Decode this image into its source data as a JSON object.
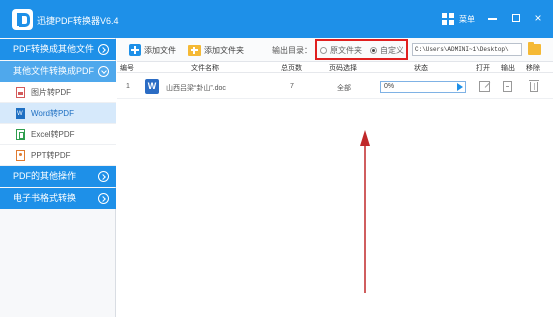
{
  "window": {
    "title": "迅捷PDF转换器V6.4",
    "menu_label": "菜单",
    "close_glyph": "×"
  },
  "sidebar": {
    "sections": [
      {
        "label": "PDF转换成其他文件"
      },
      {
        "label": "其他文件转换成PDF"
      },
      {
        "label": "PDF的其他操作"
      },
      {
        "label": "电子书格式转换"
      }
    ],
    "items": [
      {
        "label": "图片转PDF"
      },
      {
        "label": "Word转PDF"
      },
      {
        "label": "Excel转PDF"
      },
      {
        "label": "PPT转PDF"
      }
    ]
  },
  "toolbar": {
    "add_file": "添加文件",
    "add_folder": "添加文件夹",
    "output_label": "输出目录：",
    "radio_original": "原文件夹",
    "radio_custom": "自定义",
    "output_path": "C:\\Users\\ADMINI~1\\Desktop\\"
  },
  "table": {
    "headers": {
      "index": "编号",
      "name": "文件名称",
      "pages": "总页数",
      "page_select": "页码选择",
      "status": "状态",
      "open": "打开",
      "export": "输出",
      "remove": "移除"
    },
    "rows": [
      {
        "index": "1",
        "file_name": "山西吕梁“卦山”.doc",
        "pages": "7",
        "page_select": "全部",
        "progress": "0%"
      }
    ]
  },
  "colors": {
    "accent": "#1e90e8",
    "highlight_box": "#e02020",
    "annotation_arrow": "#c0282a"
  }
}
